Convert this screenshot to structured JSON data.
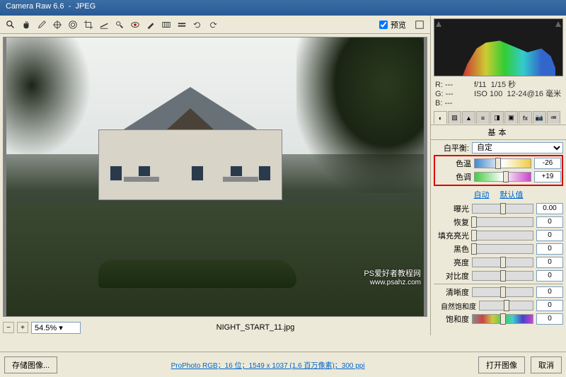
{
  "title_app": "Camera Raw 6.6",
  "title_sep": "  -  ",
  "title_format": "JPEG",
  "preview_label": "预览",
  "zoom_value": "54.5%",
  "filename": "NIGHT_START_11.jpg",
  "histogram": {
    "meta_r": "R: ---",
    "meta_g": "G: ---",
    "meta_b": "B: ---",
    "meta_ap": "f/11",
    "meta_sh": "1/15 秒",
    "meta_iso": "ISO 100",
    "meta_lens": "12-24@16 毫米"
  },
  "panel_title": "基本",
  "wb_label": "白平衡:",
  "wb_value": "自定",
  "sliders": {
    "temp": {
      "label": "色温",
      "value": "-26",
      "pos": 42
    },
    "tint": {
      "label": "色调",
      "value": "+19",
      "pos": 56
    }
  },
  "link_auto": "自动",
  "link_default": "默认值",
  "adj": {
    "exposure": {
      "label": "曝光",
      "value": "0.00",
      "pos": 50
    },
    "recovery": {
      "label": "恢复",
      "value": "0",
      "pos": 2
    },
    "fill": {
      "label": "填充亮光",
      "value": "0",
      "pos": 2
    },
    "blacks": {
      "label": "黑色",
      "value": "0",
      "pos": 2
    },
    "brightness": {
      "label": "亮度",
      "value": "0",
      "pos": 50
    },
    "contrast": {
      "label": "对比度",
      "value": "0",
      "pos": 50
    },
    "clarity": {
      "label": "清晰度",
      "value": "0",
      "pos": 50
    },
    "vibrance": {
      "label": "自然饱和度",
      "value": "0",
      "pos": 50
    },
    "saturation": {
      "label": "饱和度",
      "value": "0",
      "pos": 50
    }
  },
  "btn_save": "存储图像...",
  "meta_line": "ProPhoto RGB；16 位；1549 x 1037 (1.6 百万像素)；300 ppi",
  "btn_open": "打开图像",
  "btn_cancel": "取消",
  "watermark_main": "PS爱好者教程网",
  "watermark_url": "www.psahz.com"
}
